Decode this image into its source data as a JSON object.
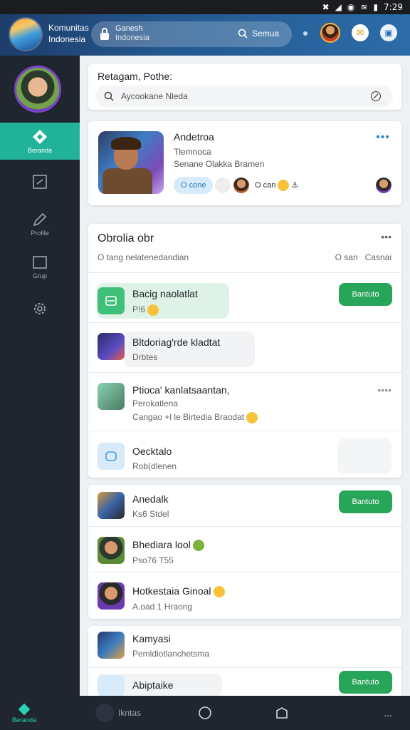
{
  "status_bar": {
    "time": "7:29"
  },
  "header": {
    "brand_line1": "Komunitas",
    "brand_line2": "Indonesia",
    "tab_line1": "Ganesh",
    "tab_line2": "Indonesia",
    "search_label": "Semua"
  },
  "sidebar": {
    "items": [
      {
        "label": "Beranda",
        "icon": "home-diamond-icon",
        "active": true
      },
      {
        "label": "",
        "icon": "chat-square-icon"
      },
      {
        "label": "Profile",
        "icon": "pencil-icon"
      },
      {
        "label": "Grup",
        "icon": "square-icon"
      },
      {
        "label": "",
        "icon": "gear-icon"
      }
    ]
  },
  "search_card": {
    "title": "Retagam, Pothe:",
    "placeholder": "Aycookane Nleda"
  },
  "hero_card": {
    "title": "Andetroa",
    "sub1": "Tlemnoca",
    "sub2": "Senane Olakka Bramen",
    "chip1": "O cone",
    "chip2": "O can"
  },
  "chat_card": {
    "title": "Obrolia obr",
    "subtitle": "O tang nelatenedandian",
    "filter_left": "O san",
    "filter_right": "Casnai",
    "rows": [
      {
        "title": "Bacig naolatlat",
        "sub": "P!6",
        "button": "Bantuto"
      },
      {
        "title": "Bltdoriag'rde kladtat",
        "sub": "Drbtes"
      },
      {
        "title": "Ptioca' kanlatsaantan,",
        "sub": "Perokatlena",
        "sub2": "Cangao +l le Birtedia Braodat"
      },
      {
        "title": "Oecktalo",
        "sub": "Rob(dlenen"
      }
    ]
  },
  "group_card": {
    "rows": [
      {
        "title": "Anedalk",
        "sub": "Ks6 Stdel",
        "button": "Bantuto"
      },
      {
        "title": "Bhediara lool",
        "sub": "Pso76 T55"
      },
      {
        "title": "Hotkestaia Ginoal",
        "sub": "A.oad 1 Hraong"
      }
    ]
  },
  "last_card": {
    "rows": [
      {
        "title": "Kamyasi",
        "sub": "Pemldiotlanchetsma"
      },
      {
        "title": "Abiptaike",
        "button": "Bantuto"
      }
    ]
  },
  "bottom_nav": {
    "items": [
      {
        "label": "Beranda",
        "active": true
      },
      {
        "label": "Ikntas"
      },
      {
        "label": ""
      },
      {
        "label": ""
      },
      {
        "label": "..."
      }
    ]
  },
  "colors": {
    "accent": "#20b39a",
    "header": "#24588f",
    "join": "#27a65a",
    "sidebar": "#1f262f"
  }
}
